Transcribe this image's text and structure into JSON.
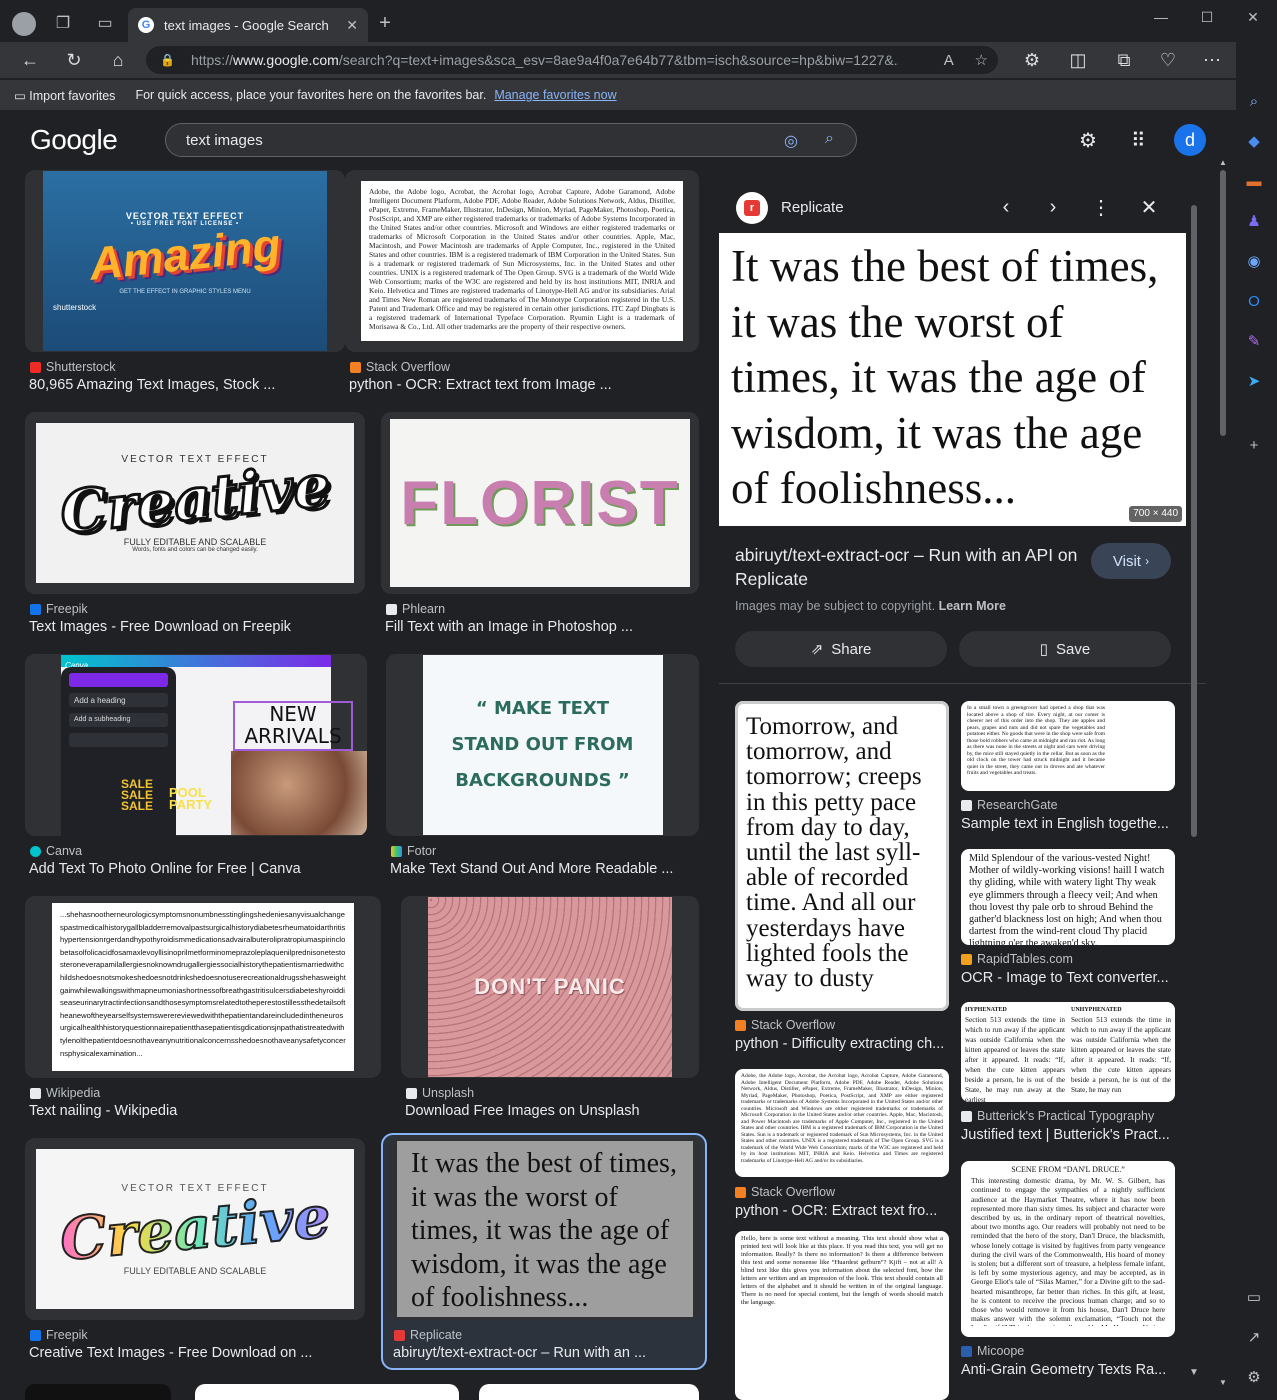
{
  "browser": {
    "tab_title": "text images - Google Search",
    "url_prefix": "https://",
    "url_domain": "www.google.com",
    "url_rest": "/search?q=text+images&sca_esv=8ae9a4f0a7e64b77&tbm=isch&source=hp&biw=1227&...",
    "fav_import": "Import favorites",
    "fav_hint": "For quick access, place your favorites here on the favorites bar.",
    "fav_link": "Manage favorites now"
  },
  "google": {
    "logo": "Google",
    "query": "text images",
    "avatar_letter": "d"
  },
  "results": [
    {
      "source": "Shutterstock",
      "title": "80,965 Amazing Text Images, Stock ...",
      "img_top": "VECTOR TEXT EFFECT",
      "img_top2": "• USE FREE FONT LICENSE •",
      "img_big": "Amazing",
      "img_bot": "GET THE EFFECT IN GRAPHIC STYLES MENU",
      "img_mark": "shutterstock"
    },
    {
      "source": "Stack Overflow",
      "title": "python - OCR: Extract text from Image ...",
      "img_text": "Adobe, the Adobe logo, Acrobat, the Acrobat logo, Acrobat Capture, Adobe Garamond, Adobe Intelligent Document Platform, Adobe PDF, Adobe Reader, Adobe Solutions Network, Aldus, Distiller, ePaper, Extreme, FrameMaker, Illustrator, InDesign, Minion, Myriad, PageMaker, Photoshop, Poetica, PostScript, and XMP are either registered trademarks or trademarks of Adobe Systems Incorporated in the United States and/or other countries. Microsoft and Windows are either registered trademarks or trademarks of Microsoft Corporation in the United States and/or other countries. Apple, Mac, Macintosh, and Power Macintosh are trademarks of Apple Computer, Inc., registered in the United States and other countries. IBM is a registered trademark of IBM Corporation in the United States. Sun is a trademark or registered trademark of Sun Microsystems, Inc. in the United States and other countries. UNIX is a registered trademark of The Open Group. SVG is a trademark of the World Wide Web Consortium; marks of the W3C are registered and held by its host institutions MIT, INRIA and Keio. Helvetica and Times are registered trademarks of Linotype-Hell AG and/or its subsidiaries. Arial and Times New Roman are registered trademarks of The Monotype Corporation registered in the U.S. Patent and Trademark Office and may be registered in certain other jurisdictions. ITC Zapf Dingbats is a registered trademark of International Typeface Corporation. Ryumin Light is a trademark of Morisawa & Co., Ltd. All other trademarks are the property of their respective owners."
    },
    {
      "source": "Freepik",
      "title": "Text Images - Free Download on Freepik",
      "img_small": "VECTOR TEXT EFFECT",
      "img_big": "Creative",
      "img_foot": "FULLY EDITABLE AND SCALABLE",
      "img_foot2": "Words, fonts and colors can be changed easily."
    },
    {
      "source": "Phlearn",
      "title": "Fill Text with an Image in Photoshop ...",
      "img_big": "FLORIST"
    },
    {
      "source": "Canva",
      "title": "Add Text To Photo Online for Free | Canva",
      "img_brand": "Canva",
      "img_heading": "Add a heading",
      "img_sub": "Add a subheading",
      "img_new": "NEW ARRIVALS",
      "img_sale": "SALE SALE SALE",
      "img_pool": "POOL PARTY"
    },
    {
      "source": "Fotor",
      "title": "Make Text Stand Out And More Readable ...",
      "img_l1": "“ MAKE TEXT",
      "img_l2": "STAND OUT FROM",
      "img_l3": "BACKGROUNDS ”"
    },
    {
      "source": "Wikipedia",
      "title": "Text nailing - Wikipedia",
      "img_text": "...shehasnootherneurologicsymptomsnonumbnesstinglingshedeniesanyvisualchangespastmedicalhistorygallbladderremovalpastsurgicalhistorydiabetesrheumatoidarthritishypertensionrgerdandhypothyroidismmedicationsadvairalbuterolipratropiumaspirinclobetasolfolicacidfosamaxlevoyllisinoprilmetforminomeprazoleplaquenilprednisonetestosteroneverapamilallergiesnoknowndrugallergiessocialhistorythepatientismarriedwithchildshedoesnotsmokeshedoesnotdrinkshedoesnotuserecreationaldrugsshehasweightgainwhilewalkingswithmapneumoniashortnessofbreathgastritisulcersdiabeteshyroiddiseaseurinarytractinfectionsandthosesymptomsrelatedtotheperestostillessthedetailsoftheanewoftheyearselfsystemswerereviewedwiththepatientandareincludedintheneurosurgicalhealthhistoryquestionnairepatientthasepatientisgdicationsjnpathatistreatedwithtylenolthepatientdoesnothaveanynutritionalconcernsshedoesnothaveanysafetyconcernsphysicalexamination..."
    },
    {
      "source": "Unsplash",
      "title": "Download Free Images on Unsplash",
      "img_big": "DON'T PANIC"
    },
    {
      "source": "Freepik",
      "title": "Creative Text Images - Free Download on ...",
      "img_small": "VECTOR TEXT EFFECT",
      "img_big": "Creative",
      "img_foot": "FULLY EDITABLE AND SCALABLE"
    },
    {
      "source": "Replicate",
      "title": "abiruyt/text-extract-ocr – Run with an ...",
      "img_text": "It was the best of times, it was the worst of times, it was the age of wisdom, it was the age of foolishness..."
    }
  ],
  "panel": {
    "source": "Replicate",
    "preview_text": "It was the best of times, it was the worst of times, it was the age of wisdom, it was the age of foolishness...",
    "dims": "700 × 440",
    "title": "abiruyt/text-extract-ocr – Run with an API on Replicate",
    "visit": "Visit",
    "copyright": "Images may be subject to copyright.",
    "learn_more": "Learn More",
    "share": "Share",
    "save": "Save"
  },
  "related": [
    {
      "source": "Stack Overflow",
      "title": "python - Difficulty extracting ch...",
      "img_text": "Tomorrow, and tomorrow, and tomorrow; creeps in this petty pace from day to day, until the last syll-able of recorded time. And all our yesterdays have lighted fools the way to dusty"
    },
    {
      "source": "ResearchGate",
      "title": "Sample text in English togethe...",
      "img_text": "In a small town a greengrocer had opened a shop that was located above a shop of tire. Every night, at our comer is cheerer net of this order into the shop. They ate apples and pears, grapes and nuts and did not spare the vegetables and potatoes either. No goods that were in the shop were safe from those bold robbers who came at midnight and ran riot. As long as there was none in the streets at night and cars were driving by, the mice still stayed quietly in the cellar. But as soon as the old clock on the tower had struck midnight and it became quiet in the street, they came out in droves and ate whatever fruits and vegetables and treats."
    },
    {
      "source": "RapidTables.com",
      "title": "OCR - Image to Text converter...",
      "img_text": "Mild Splendour of the various-vested Night! Mother of wildly-working visions! haill I watch thy gliding, while with watery light Thy weak eye glimmers through a fleecy veil; And when thou lovest thy pale orb to shroud Behind the gather'd blackness lost on high; And when thou dartest from the wind-rent cloud Thy placid lightning o'er the awaken'd sky."
    },
    {
      "source": "Butterick's Practical Typography",
      "title": "Justified text | Butterick's Pract...",
      "img_left_head": "HYPHENATED",
      "img_right_head": "UNHYPHENATED",
      "img_left": "Section 513 extends the time in which to run away if the applicant was outside California when the kitten appeared or leaves the state after it appeared. It reads: “If, when the cute kitten appears beside a person, he is out of the State, he may run away at the earliest",
      "img_right": "Section 513 extends the time in which to run away if the applicant was outside California when the kitten appeared or leaves the state after it appeared. It reads: “If, when the cute kitten appears beside a person, he is out of the State, he may run"
    },
    {
      "source": "Stack Overflow",
      "title": "python - OCR: Extract text fro...",
      "img_text": "Adobe, the Adobe logo, Acrobat, the Acrobat logo, Acrobat Capture, Adobe Garamond, Adobe Intelligent Document Platform, Adobe PDF, Adobe Reader, Adobe Solutions Network, Aldus, Distiller, ePaper, Extreme, FrameMaker, Illustrator, InDesign, Minion, Myriad, PageMaker, Photoshop, Poetica, PostScript, and XMP are either registered trademarks or trademarks of Adobe Systems Incorporated in the United States and/or other countries. Microsoft and Windows are either registered trademarks or trademarks of Microsoft Corporation in the United States and/or other countries. Apple, Mac, Macintosh, and Power Macintosh are trademarks of Apple Computer, Inc., registered in the United States and other countries. IBM is a registered trademark of IBM Corporation in the United States. Sun is a trademark or registered trademark of Sun Microsystems, Inc. in the United States and other countries. UNIX is a registered trademark of The Open Group. SVG is a trademark of the World Wide Web Consortium; marks of the W3C are registered and held by its host institutions MIT, INRIA and Keio. Helvetica and Times are registered trademarks of Linotype-Hell AG and/or its subsidiaries."
    },
    {
      "source": "Micoope",
      "title": "Anti-Grain Geometry Texts Ra...",
      "img_head": "SCENE FROM “DAN'L DRUCE.”",
      "img_text": "This interesting domestic drama, by Mr. W. S. Gilbert, has continued to engage the sympathies of a nightly sufficient audience at the Haymarket Theatre, where it has now been represented more than sixty times. Its subject and character were described by us, in the ordinary report of theatrical novelties, about two months ago. Our readers will probably not need to be reminded that the hero of the story, Dan'l Druce, the blacksmith, whose lonely cottage is visited by fugitives from party vengeance during the civil wars of the Commonwealth, His hoard of money is stolen; but a different sort of treasure, a helpless female infant, is left by some mysterious agency, and may be accepted, as in George Eliot's tale of “Silas Marner,” for a Divine gift to the sad-hearted misanthrope, far better than riches. In this gift, at least, he is content to receive the precious human charge; and so to those who would remove it from his house, Dan'l Druce here makes answer with the solemn exclamation, “Touch not the Lord's gift!” This character is well acted by Mr. Hermann Vezin."
    },
    {
      "source": "",
      "title": "",
      "img_text": "Hello, here is some text without a meaning. This text should show what a printed text will look like at this place. If you read this text, you will get no information. Really? Is there no information? Is there a difference between this text and some nonsense like “Huardest gefburn”? Kjift – not at all! A blind text like this gives you information about the selected font, how the letters are written and an impression of the look. This text should contain all letters of the alphabet and it should be written in of the original language. There is no need for special content, but the length of words should match the language."
    }
  ],
  "colors": {
    "accent": "#8ab4f8",
    "avatar": "#1a73e8",
    "bg": "#202124"
  }
}
